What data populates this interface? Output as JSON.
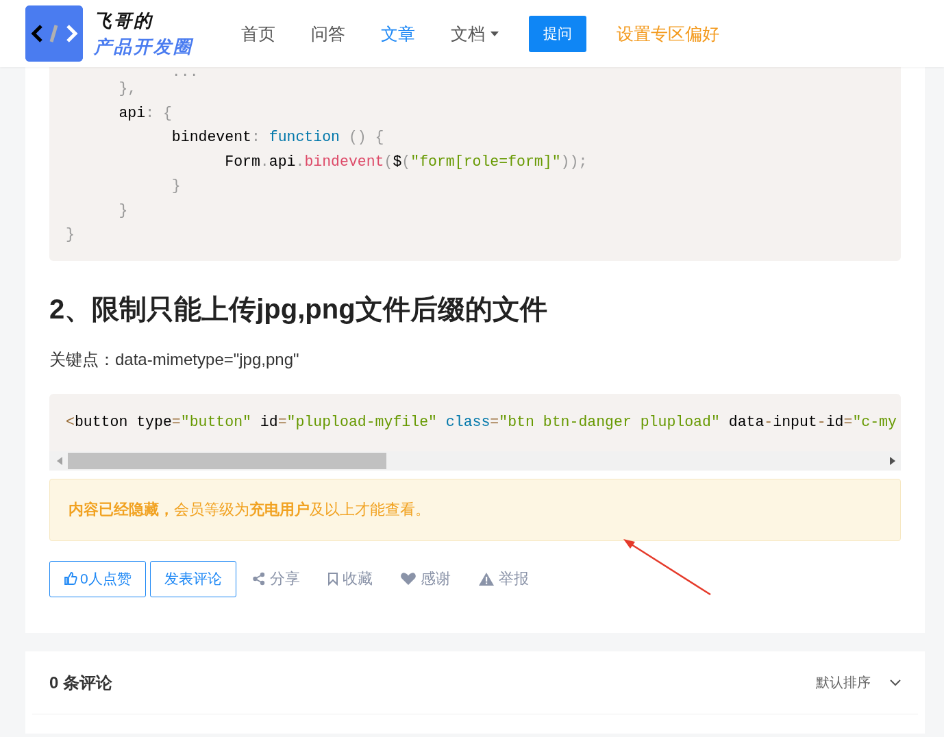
{
  "header": {
    "logo": {
      "line_1": "飞哥的",
      "line_2": "产品开发圈"
    },
    "nav": [
      {
        "label": "首页",
        "selected": false,
        "dropdown": false
      },
      {
        "label": "问答",
        "selected": false,
        "dropdown": false
      },
      {
        "label": "文章",
        "selected": true,
        "dropdown": false
      },
      {
        "label": "文档",
        "selected": false,
        "dropdown": true
      }
    ],
    "ask_button": "提问",
    "preferences_link": "设置专区偏好"
  },
  "article": {
    "code_block_1": [
      [
        {
          "kind": "punct",
          "text": "            ..."
        }
      ],
      [
        {
          "kind": "punct",
          "text": "      },"
        }
      ],
      [
        {
          "kind": "text",
          "text": "      api"
        },
        {
          "kind": "punct",
          "text": ": {"
        }
      ],
      [
        {
          "kind": "text",
          "text": "            bindevent"
        },
        {
          "kind": "punct",
          "text": ": "
        },
        {
          "kind": "keyword",
          "text": "function"
        },
        {
          "kind": "punct",
          "text": " () {"
        }
      ],
      [
        {
          "kind": "text",
          "text": "                  Form"
        },
        {
          "kind": "punct",
          "text": "."
        },
        {
          "kind": "text",
          "text": "api"
        },
        {
          "kind": "punct",
          "text": "."
        },
        {
          "kind": "func",
          "text": "bindevent"
        },
        {
          "kind": "punct",
          "text": "("
        },
        {
          "kind": "text",
          "text": "$"
        },
        {
          "kind": "punct",
          "text": "("
        },
        {
          "kind": "string",
          "text": "\"form[role=form]\""
        },
        {
          "kind": "punct",
          "text": "));"
        }
      ],
      [
        {
          "kind": "punct",
          "text": "            }"
        }
      ],
      [
        {
          "kind": "punct",
          "text": "      }"
        }
      ],
      [
        {
          "kind": "punct",
          "text": "}"
        }
      ]
    ],
    "heading": "2、限制只能上传jpg,png文件后缀的文件",
    "paragraph": "关键点：data-mimetype=\"jpg,png\"",
    "code_block_2": [
      [
        {
          "kind": "operator",
          "text": "<"
        },
        {
          "kind": "text",
          "text": "button type"
        },
        {
          "kind": "operator",
          "text": "="
        },
        {
          "kind": "string",
          "text": "\"button\""
        },
        {
          "kind": "text",
          "text": " id"
        },
        {
          "kind": "operator",
          "text": "="
        },
        {
          "kind": "string",
          "text": "\"plupload-myfile\" "
        },
        {
          "kind": "keyword",
          "text": "class"
        },
        {
          "kind": "operator",
          "text": "="
        },
        {
          "kind": "string",
          "text": "\"btn btn-danger plupload\""
        },
        {
          "kind": "text",
          "text": " data"
        },
        {
          "kind": "operator",
          "text": "-"
        },
        {
          "kind": "text",
          "text": "input"
        },
        {
          "kind": "operator",
          "text": "-"
        },
        {
          "kind": "text",
          "text": "id"
        },
        {
          "kind": "operator",
          "text": "="
        },
        {
          "kind": "string",
          "text": "\"c-my"
        }
      ]
    ],
    "notice": "**内容已经隐藏，** 会员等级为**充电用户**及以上才能查看。",
    "like_button": "0人点赞",
    "comment_button": "发表评论",
    "actions": [
      {
        "kind": "share",
        "label": "分享"
      },
      {
        "kind": "bookmark",
        "label": "收藏"
      },
      {
        "kind": "heart",
        "label": "感谢"
      },
      {
        "kind": "warning",
        "label": "举报"
      }
    ]
  },
  "comments": {
    "title": "0 条评论",
    "sort": "默认排序"
  }
}
